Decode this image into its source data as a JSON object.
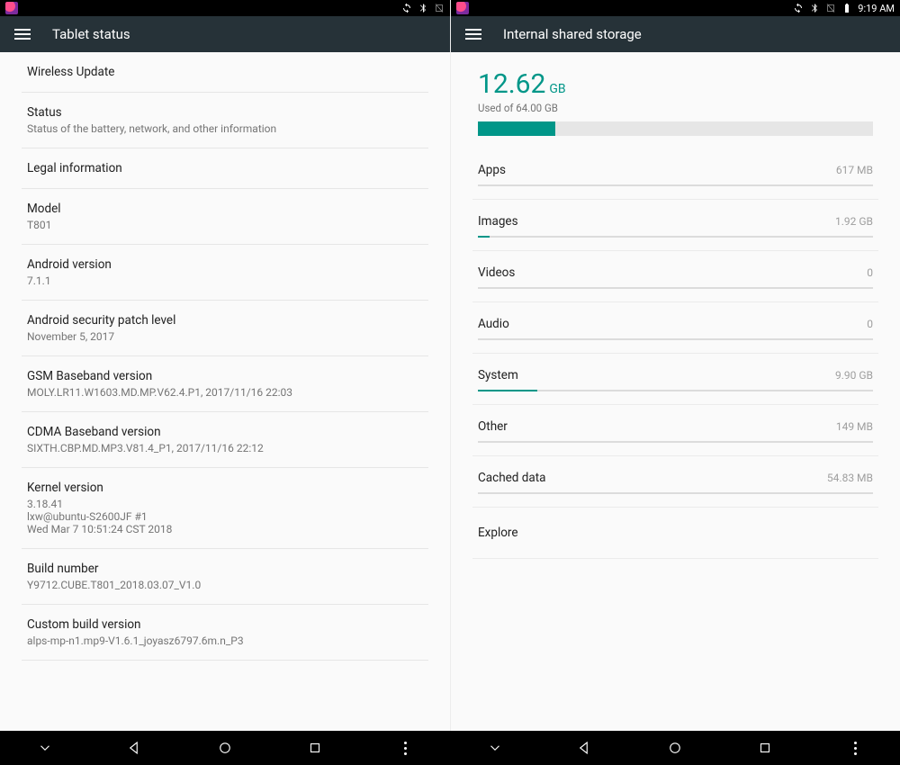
{
  "status": {
    "time": "9:19 AM"
  },
  "left": {
    "title": "Tablet status",
    "rows": [
      {
        "title": "Wireless Update",
        "sub": ""
      },
      {
        "title": "Status",
        "sub": "Status of the battery, network, and other information"
      },
      {
        "title": "Legal information",
        "sub": ""
      },
      {
        "title": "Model",
        "sub": "T801"
      },
      {
        "title": "Android version",
        "sub": "7.1.1"
      },
      {
        "title": "Android security patch level",
        "sub": "November 5, 2017"
      },
      {
        "title": "GSM Baseband version",
        "sub": "MOLY.LR11.W1603.MD.MP.V62.4.P1, 2017/11/16 22:03"
      },
      {
        "title": "CDMA Baseband version",
        "sub": "SIXTH.CBP.MD.MP3.V81.4_P1, 2017/11/16 22:12"
      },
      {
        "title": "Kernel version",
        "sub": "3.18.41\nlxw@ubuntu-S2600JF #1\nWed Mar 7 10:51:24 CST 2018"
      },
      {
        "title": "Build number",
        "sub": "Y9712.CUBE.T801_2018.03.07_V1.0"
      },
      {
        "title": "Custom build version",
        "sub": "alps-mp-n1.mp9-V1.6.1_joyasz6797.6m.n_P3"
      }
    ]
  },
  "right": {
    "title": "Internal shared storage",
    "used_value": "12.62",
    "used_unit": "GB",
    "used_label": "Used of 64.00 GB",
    "used_pct": 19.7,
    "categories": [
      {
        "name": "Apps",
        "size": "617 MB",
        "pct": 0
      },
      {
        "name": "Images",
        "size": "1.92 GB",
        "pct": 3
      },
      {
        "name": "Videos",
        "size": "0",
        "pct": 0
      },
      {
        "name": "Audio",
        "size": "0",
        "pct": 0
      },
      {
        "name": "System",
        "size": "9.90 GB",
        "pct": 15
      },
      {
        "name": "Other",
        "size": "149 MB",
        "pct": 0
      },
      {
        "name": "Cached data",
        "size": "54.83 MB",
        "pct": 0
      }
    ],
    "explore": "Explore"
  }
}
